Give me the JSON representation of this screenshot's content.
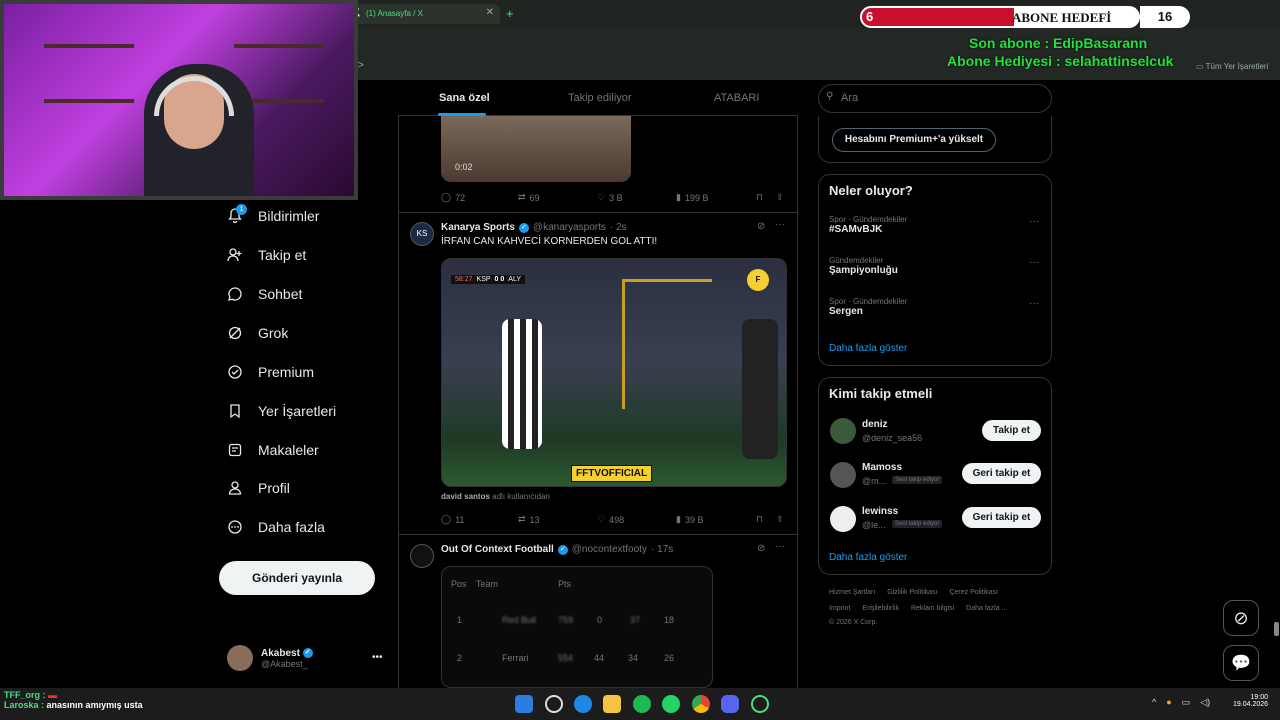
{
  "browser": {
    "tab_title": "(1) Anasayfa / X",
    "bookmark_label": "Tüm Yer İşaretleri"
  },
  "overlay": {
    "goal_current": "6",
    "goal_title": "ABONE HEDEFİ",
    "goal_target": "16",
    "last_sub": "Son abone : EdipBasarann",
    "gift_sub": "Abone Hediyesi : selahattinselcuk"
  },
  "nav": {
    "items": [
      {
        "label": "Bildirimler",
        "icon": "bell-icon"
      },
      {
        "label": "Takip et",
        "icon": "add-user-icon"
      },
      {
        "label": "Sohbet",
        "icon": "chat-icon"
      },
      {
        "label": "Grok",
        "icon": "grok-icon"
      },
      {
        "label": "Premium",
        "icon": "premium-icon"
      },
      {
        "label": "Yer İşaretleri",
        "icon": "bookmark-icon"
      },
      {
        "label": "Makaleler",
        "icon": "article-icon"
      },
      {
        "label": "Profil",
        "icon": "profile-icon"
      },
      {
        "label": "Daha fazla",
        "icon": "more-icon"
      }
    ],
    "notif_count": "1",
    "post_button": "Gönderi yayınla",
    "profile_name": "Akabest",
    "profile_handle": "@Akabest_"
  },
  "feed": {
    "tabs": [
      "Sana özel",
      "Takip ediliyor",
      "ATABARI"
    ],
    "tweet0": {
      "video_time": "0:02",
      "replies": "72",
      "retweets": "69",
      "likes": "3 B",
      "views": "199 B"
    },
    "tweet1": {
      "avatar_text": "KS",
      "name": "Kanarya Sports",
      "handle": "@kanaryasports",
      "time": "· 2s",
      "text": "İRFAN CAN KAHVECİ KORNERDEN GOL ATTI!",
      "score_clock": "58:27",
      "score_home": "KSP",
      "score": "0  0",
      "score_away": "ALY",
      "watermark": "FFTVOFFICIAL",
      "source_user": "david santos",
      "source_suffix": "adlı kullanıcıdan",
      "replies": "11",
      "retweets": "13",
      "likes": "498",
      "views": "39 B"
    },
    "tweet2": {
      "name": "Out Of Context Football",
      "handle": "@nocontextfooty",
      "time": "· 17s",
      "table_headers": [
        "Pos",
        "Team",
        "Pts"
      ],
      "rows": [
        {
          "pos": "1",
          "team": "Red Bull",
          "pts": "759",
          "a": "0",
          "b": "37",
          "c": "18"
        },
        {
          "pos": "2",
          "team": "Ferrari",
          "pts": "554",
          "a": "44",
          "b": "34",
          "c": "26"
        }
      ]
    }
  },
  "right": {
    "search_placeholder": "Ara",
    "premium_button": "Hesabını Premium+'a yükselt",
    "trends_title": "Neler oluyor?",
    "trends": [
      {
        "category": "Spor · Gündemdekiler",
        "name": "#SAMvBJK"
      },
      {
        "category": "Gündemdekiler",
        "name": "Şampiyonluğu"
      },
      {
        "category": "Spor · Gündemdekiler",
        "name": "Sergen"
      }
    ],
    "show_more": "Daha fazla göster",
    "who_title": "Kimi takip etmeli",
    "who": [
      {
        "name": "deniz",
        "handle": "@deniz_sea56",
        "badge": "",
        "button": "Takip et"
      },
      {
        "name": "Mamoss",
        "handle": "@m...",
        "badge": "Seni takip ediyor",
        "button": "Geri takip et"
      },
      {
        "name": "lewinss",
        "handle": "@le...",
        "badge": "Seni takip ediyor",
        "button": "Geri takip et"
      }
    ],
    "footer_line1": [
      "Hizmet Şartları",
      "Gizlilik Politikası",
      "Çerez Politikası"
    ],
    "footer_line2": [
      "Imprint",
      "Erişilebilirlik",
      "Reklam bilgisi",
      "Daha fazla ..."
    ],
    "copyright": "© 2026 X Corp."
  },
  "chat": {
    "line1_user": "TFF_org :",
    "line2_user": "Laroska :",
    "line2_text": "anasının amıymış usta"
  },
  "clock": {
    "time": "19:00",
    "date": "19.04.2026"
  }
}
